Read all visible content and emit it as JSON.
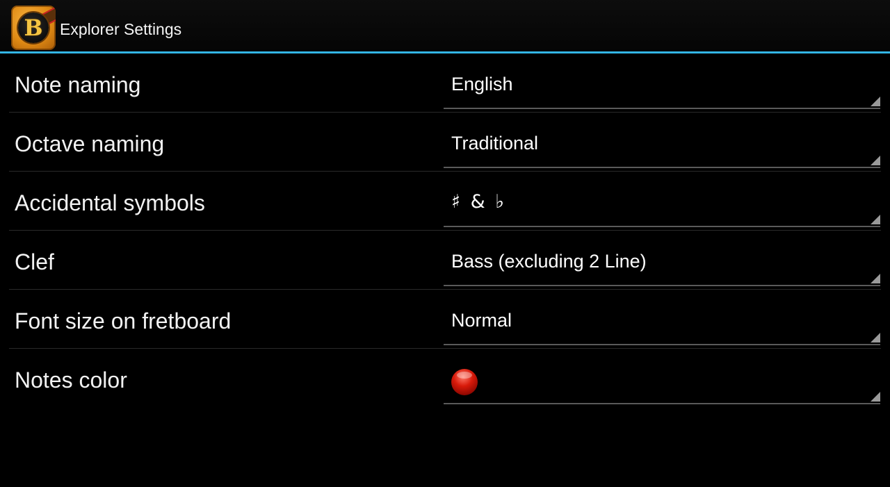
{
  "action_bar": {
    "title": "Explorer Settings",
    "app_icon": "guitar-b-logo-icon",
    "app_icon_letter": "B",
    "accent_color": "#33b5e5"
  },
  "settings": [
    {
      "label": "Note naming",
      "value": "English"
    },
    {
      "label": "Octave naming",
      "value": "Traditional"
    },
    {
      "label": "Accidental symbols",
      "value": "♯ & ♭"
    },
    {
      "label": "Clef",
      "value": "Bass (excluding 2 Line)"
    },
    {
      "label": "Font size on fretboard",
      "value": "Normal"
    },
    {
      "label": "Notes color",
      "value_color": "#d81a0a"
    }
  ]
}
